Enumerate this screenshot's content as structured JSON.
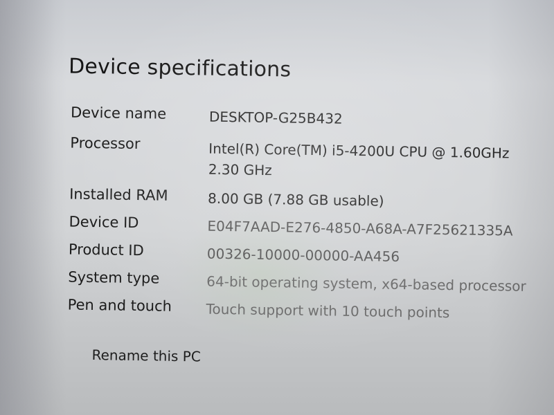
{
  "section": {
    "title": "Device specifications"
  },
  "specs": [
    {
      "label": "Device name",
      "value": "DESKTOP-G25B432"
    },
    {
      "label": "Processor",
      "value": "Intel(R) Core(TM) i5-4200U CPU @ 1.60GHz",
      "value_line2": "2.30 GHz"
    },
    {
      "label": "Installed RAM",
      "value": "8.00 GB (7.88 GB usable)"
    },
    {
      "label": "Device ID",
      "value": "E04F7AAD-E276-4850-A68A-A7F25621335A"
    },
    {
      "label": "Product ID",
      "value": "00326-10000-00000-AA456"
    },
    {
      "label": "System type",
      "value": "64-bit operating system, x64-based processor"
    },
    {
      "label": "Pen and touch",
      "value": "Touch support with 10 touch points"
    }
  ],
  "actions": {
    "rename_label": "Rename this PC"
  }
}
